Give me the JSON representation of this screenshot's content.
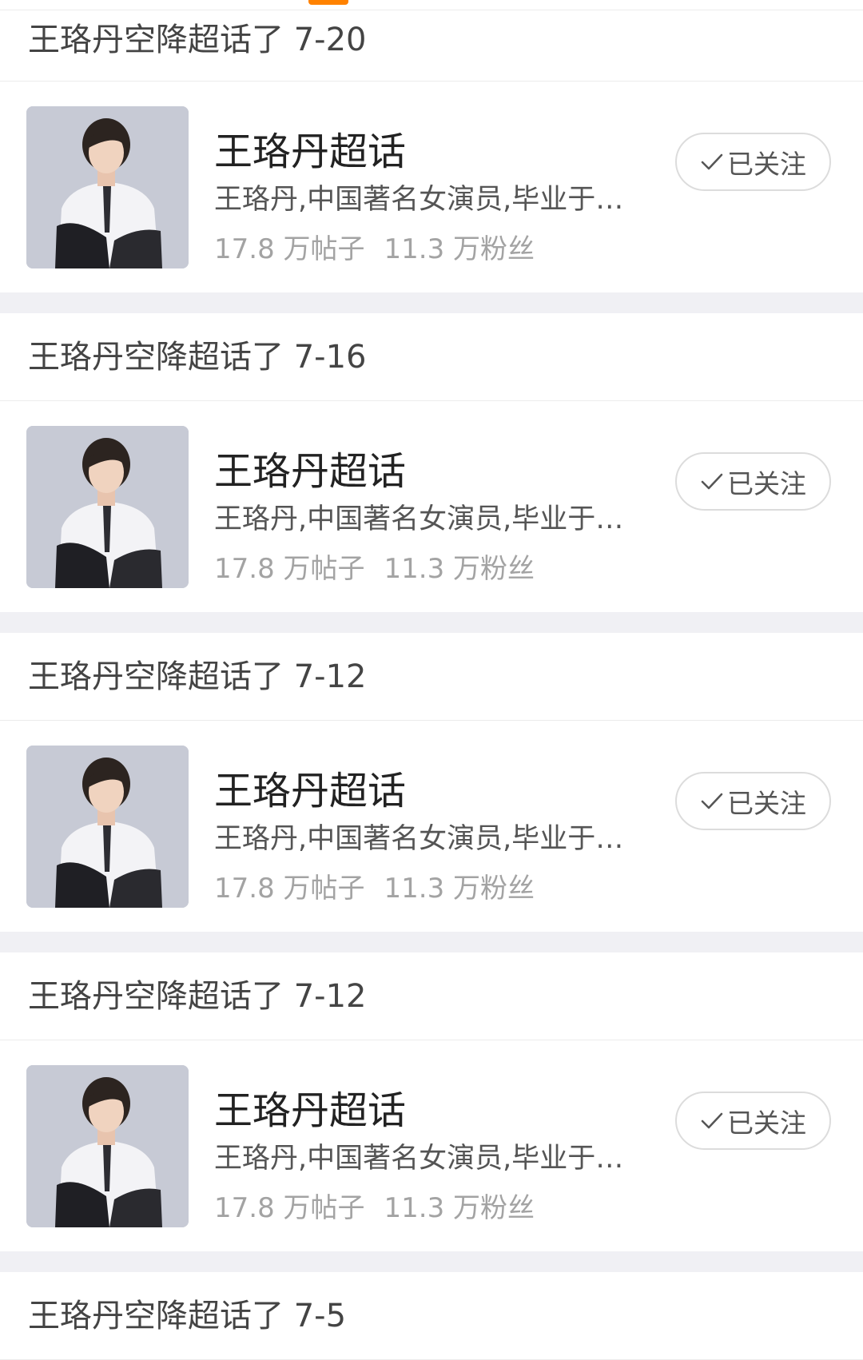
{
  "feed": [
    {
      "header": "王珞丹空降超话了 7-20",
      "card": {
        "title": "王珞丹超话",
        "description": "王珞丹,中国著名女演员,毕业于北京电影学院",
        "posts": "17.8 万帖子",
        "fans": "11.3 万粉丝",
        "follow_label": "已关注"
      }
    },
    {
      "header": "王珞丹空降超话了 7-16",
      "card": {
        "title": "王珞丹超话",
        "description": "王珞丹,中国著名女演员,毕业于北京电影学院",
        "posts": "17.8 万帖子",
        "fans": "11.3 万粉丝",
        "follow_label": "已关注"
      }
    },
    {
      "header": "王珞丹空降超话了 7-12",
      "card": {
        "title": "王珞丹超话",
        "description": "王珞丹,中国著名女演员,毕业于北京电影学院",
        "posts": "17.8 万帖子",
        "fans": "11.3 万粉丝",
        "follow_label": "已关注"
      }
    },
    {
      "header": "王珞丹空降超话了 7-12",
      "card": {
        "title": "王珞丹超话",
        "description": "王珞丹,中国著名女演员,毕业于北京电影学院",
        "posts": "17.8 万帖子",
        "fans": "11.3 万粉丝",
        "follow_label": "已关注"
      }
    },
    {
      "header": "王珞丹空降超话了 7-5"
    }
  ],
  "icons": {
    "follow": "check-icon",
    "avatar": "portrait-photo"
  },
  "colors": {
    "accent": "#ff8200",
    "background": "#ffffff",
    "divider": "#f0f0f4",
    "muted_text": "#a3a3a3"
  }
}
